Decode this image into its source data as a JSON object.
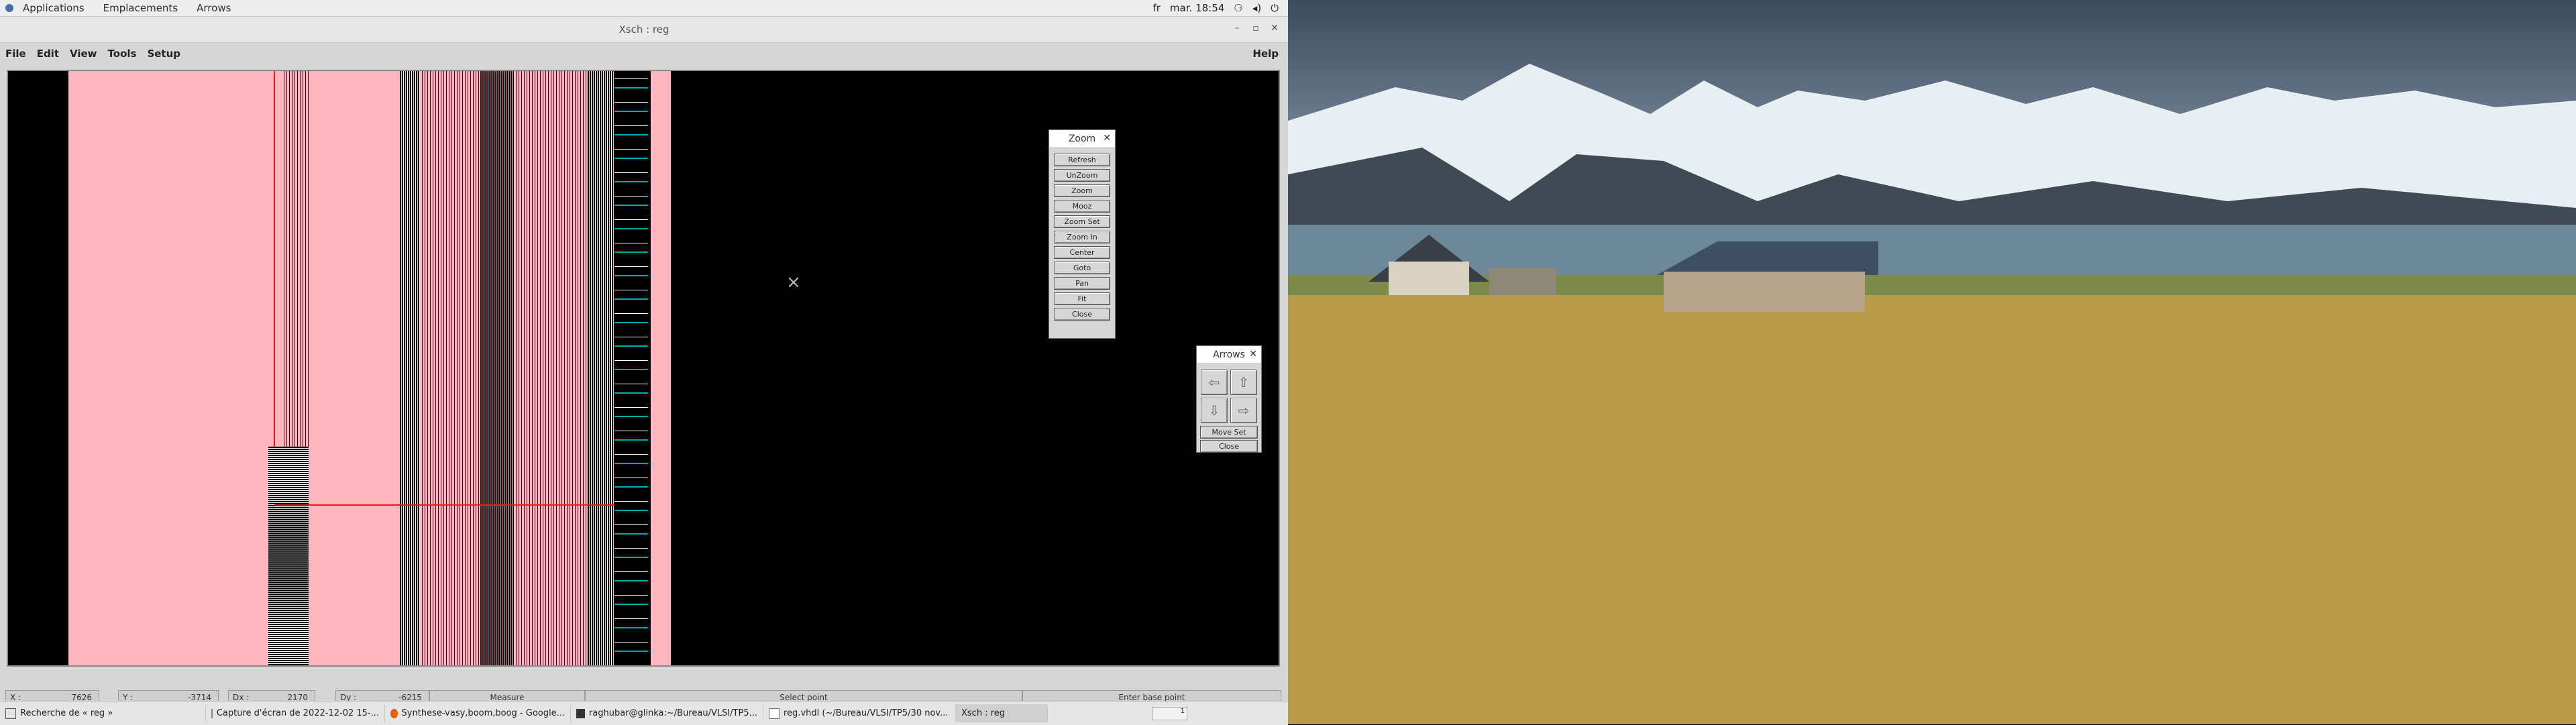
{
  "topbar": {
    "menus": [
      "Applications",
      "Emplacements",
      "Arrows"
    ],
    "lang": "fr",
    "clock": "mar. 18:54"
  },
  "window": {
    "title": "Xsch : reg",
    "menus": [
      "File",
      "Edit",
      "View",
      "Tools",
      "Setup"
    ],
    "help": "Help"
  },
  "zoom_panel": {
    "title": "Zoom",
    "buttons": [
      "Refresh",
      "UnZoom",
      "Zoom",
      "Mooz",
      "Zoom Set",
      "Zoom In",
      "Center",
      "Goto",
      "Pan",
      "Fit",
      "Close"
    ]
  },
  "arrows_panel": {
    "title": "Arrows",
    "move_set": "Move Set",
    "close": "Close"
  },
  "status": {
    "x_label": "X :",
    "x_value": "7626",
    "y_label": "Y :",
    "y_value": "-3714",
    "dx_label": "Dx :",
    "dx_value": "2170",
    "dy_label": "Dy :",
    "dy_value": "-6215",
    "measure": "Measure",
    "select": "Select point",
    "enter": "Enter base point"
  },
  "taskbar": {
    "items": [
      "Recherche de « reg »",
      "Capture d'écran de 2022-12-02 15-...",
      "Synthese-vasy,boom,boog - Google...",
      "raghubar@glinka:~/Bureau/VLSI/TP5...",
      "reg.vhdl (~/Bureau/VLSI/TP5/30 nov...",
      "Xsch : reg"
    ],
    "workspace": "1"
  },
  "colors": {
    "layout_pink": "#ffb6c1",
    "panel_gray": "#d6d6d6"
  },
  "icons": {
    "close": "close-icon",
    "power": "power-icon",
    "network": "network-icon"
  }
}
